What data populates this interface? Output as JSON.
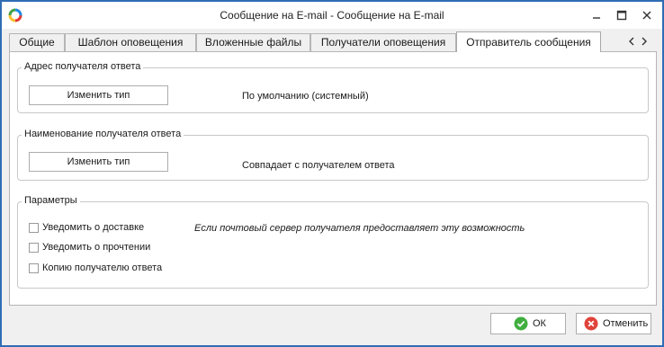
{
  "window": {
    "title": "Сообщение на E-mail - Сообщение на E-mail"
  },
  "tabs": [
    {
      "label": "Общие"
    },
    {
      "label": "Шаблон оповещения"
    },
    {
      "label": "Вложенные файлы"
    },
    {
      "label": "Получатели оповещения"
    },
    {
      "label": "Отправитель сообщения"
    }
  ],
  "active_tab": "Отправитель сообщения",
  "reply_address": {
    "caption": "Адрес получателя ответа",
    "button_label": "Изменить тип",
    "value": "По умолчанию (системный)"
  },
  "reply_name": {
    "caption": "Наименование получателя ответа",
    "button_label": "Изменить тип",
    "value": "Совпадает с получателем ответа"
  },
  "params": {
    "caption": "Параметры",
    "checkboxes": [
      {
        "label": "Уведомить о доставке",
        "checked": false
      },
      {
        "label": "Уведомить о прочтении",
        "checked": false
      },
      {
        "label": "Копию получателю ответа",
        "checked": false
      }
    ],
    "note": "Если почтовый сервер получателя предоставляет эту возможность"
  },
  "footer": {
    "ok_label": "ОК",
    "cancel_label": "Отменить"
  },
  "colors": {
    "window_border": "#2f6db5",
    "ok_icon": "#3fae3f",
    "cancel_icon": "#e0433a"
  },
  "icons": {
    "app": "app-logo-icon",
    "minimize": "minimize-icon",
    "maximize": "maximize-icon",
    "close": "close-icon",
    "ok": "check-circle-icon",
    "cancel": "cancel-circle-icon"
  }
}
